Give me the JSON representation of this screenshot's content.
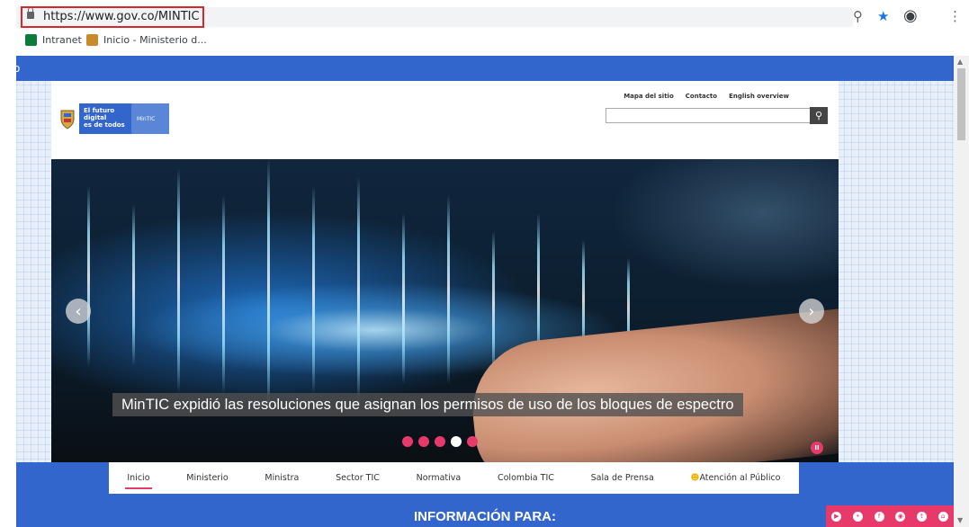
{
  "browser": {
    "url": "https://www.gov.co/MINTIC",
    "icons": [
      "zoom-icon",
      "star-icon",
      "account-icon",
      "menu-icon"
    ],
    "bookmarks": [
      {
        "label": "Intranet",
        "icon": "sharepoint-icon",
        "color": "#0b7a3b"
      },
      {
        "label": "Inicio - Ministerio d...",
        "icon": "ministerio-icon",
        "color": "#c88b2a"
      }
    ]
  },
  "site": {
    "topstrip_text": "o",
    "logo": {
      "line1": "El futuro digital",
      "line2": "es de todos",
      "badge": "MinTIC"
    },
    "toplinks": [
      "Mapa del sitio",
      "Contacto",
      "English overview"
    ],
    "search": {
      "placeholder": "",
      "button_icon": "search-icon"
    },
    "hero": {
      "caption": "MinTIC expidió las resoluciones que asignan los permisos de uso de los bloques de espectro",
      "dots": 5,
      "active_dot": 3
    },
    "nav": [
      "Inicio",
      "Ministerio",
      "Ministra",
      "Sector TIC",
      "Normativa",
      "Colombia TIC",
      "Sala de Prensa",
      "Atención al Público"
    ],
    "active_nav": 0,
    "info_heading": "INFORMACIÓN PARA:",
    "social_icons": [
      "youtube-icon",
      "flickr-icon",
      "facebook-icon",
      "instagram-icon",
      "twitter-icon",
      "rss-icon"
    ]
  },
  "colors": {
    "primary_blue": "#3366cc",
    "accent_pink": "#e8396b",
    "highlight_red": "#d9262c"
  }
}
